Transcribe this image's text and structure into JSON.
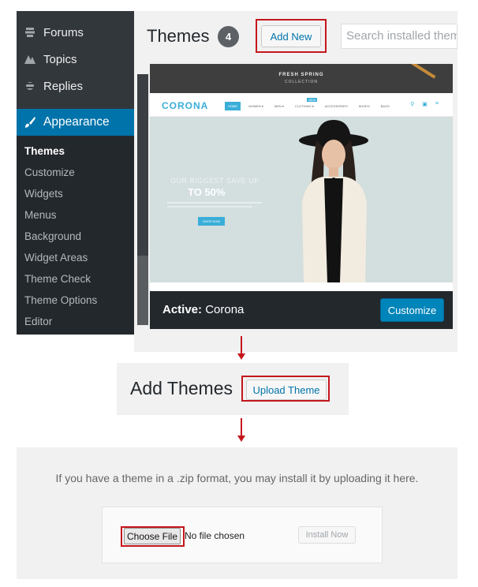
{
  "sidebar": {
    "top_items": [
      {
        "label": "Forums",
        "icon": "forums-icon"
      },
      {
        "label": "Topics",
        "icon": "topics-icon"
      },
      {
        "label": "Replies",
        "icon": "replies-icon"
      }
    ],
    "current": {
      "label": "Appearance",
      "icon": "brush-icon"
    },
    "submenu": [
      "Themes",
      "Customize",
      "Widgets",
      "Menus",
      "Background",
      "Widget Areas",
      "Theme Check",
      "Theme Options",
      "Editor"
    ],
    "active_submenu": "Themes"
  },
  "themes_page": {
    "title": "Themes",
    "count": "4",
    "add_new_label": "Add New",
    "search_placeholder": "Search installed themes"
  },
  "theme_preview": {
    "banner_line1": "FRESH SPRING",
    "banner_line2": "COLLECTION",
    "logo": "CORONA",
    "nav_items": [
      "HOME",
      "WOMEN ▾",
      "MEN ▾",
      "CLOTHING ▾",
      "ACCESSORIES",
      "SHOES",
      "BAGS"
    ],
    "nav_badge": "NEW",
    "hero_line1": "OUR BIGGEST SAVE UP",
    "hero_line2": "TO 50%",
    "hero_button": "SHOP NOW"
  },
  "active_theme": {
    "prefix": "Active:",
    "name": "Corona",
    "customize_label": "Customize"
  },
  "add_themes": {
    "title": "Add Themes",
    "upload_label": "Upload Theme"
  },
  "upload": {
    "message": "If you have a theme in a .zip format, you may install it by uploading it here.",
    "choose_file_label": "Choose File",
    "no_file_text": "No file chosen",
    "install_label": "Install Now"
  },
  "colors": {
    "admin_dark": "#23282d",
    "admin_blue": "#0073aa",
    "highlight_red": "#c4161c",
    "theme_accent": "#3aaed8"
  }
}
